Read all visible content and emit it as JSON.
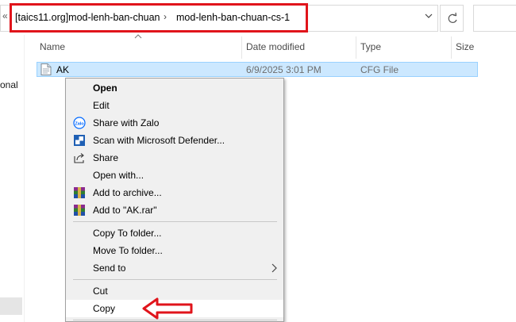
{
  "address_bar": {
    "back_glyph": "«",
    "breadcrumbs": [
      "[taics11.org]mod-lenh-ban-chuan",
      "mod-lenh-ban-chuan-cs-1"
    ],
    "separator": "›",
    "dropdown_icon": "chevron-down-icon",
    "refresh_icon": "refresh-icon",
    "highlight_color": "#e0141b"
  },
  "columns": {
    "name": "Name",
    "date_modified": "Date modified",
    "type": "Type",
    "size": "Size"
  },
  "nav_pane": {
    "partial_item": "onal"
  },
  "files": [
    {
      "name": "AK",
      "date_modified": "6/9/2025 3:01 PM",
      "type": "CFG File",
      "icon": "cfg-file-icon",
      "selected": true
    }
  ],
  "context_menu": {
    "items": [
      {
        "label": "Open",
        "bold": true
      },
      {
        "label": "Edit"
      },
      {
        "label": "Share with Zalo",
        "icon": "zalo-icon"
      },
      {
        "label": "Scan with Microsoft Defender...",
        "icon": "defender-shield-icon"
      },
      {
        "label": "Share",
        "icon": "share-icon"
      },
      {
        "label": "Open with..."
      },
      {
        "label": "Add to archive...",
        "icon": "winrar-icon"
      },
      {
        "label": "Add to \"AK.rar\"",
        "icon": "winrar-icon"
      },
      {
        "label": "Copy To folder..."
      },
      {
        "label": "Move To folder..."
      },
      {
        "label": "Send to",
        "submenu": true
      },
      {
        "label": "Cut"
      },
      {
        "label": "Copy",
        "hovered": true
      }
    ]
  },
  "annotation": {
    "arrow_icon": "red-arrow-icon",
    "color": "#e0141b"
  },
  "colors": {
    "selection_fill": "#cce8ff",
    "selection_border": "#99d1ff",
    "menu_background": "#f0f0f0"
  }
}
